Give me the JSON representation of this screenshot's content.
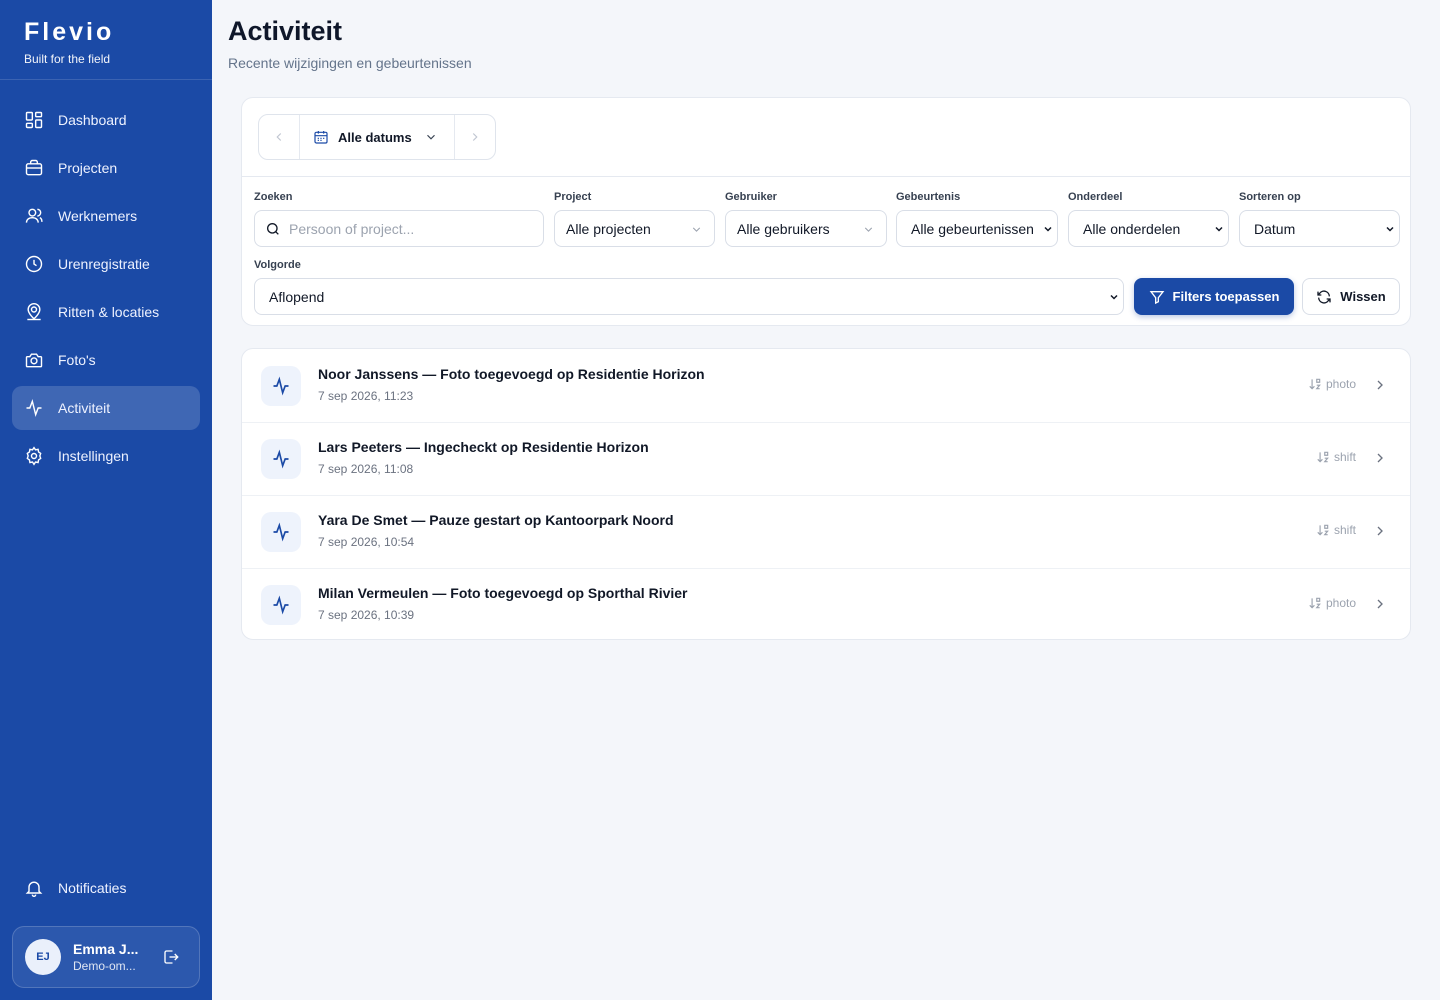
{
  "app": {
    "name": "Flevio",
    "tagline": "Built for the field"
  },
  "sidebar": {
    "items": [
      {
        "label": "Dashboard",
        "icon": "dashboard-icon"
      },
      {
        "label": "Projecten",
        "icon": "briefcase-icon"
      },
      {
        "label": "Werknemers",
        "icon": "users-icon"
      },
      {
        "label": "Urenregistratie",
        "icon": "clock-icon"
      },
      {
        "label": "Ritten & locaties",
        "icon": "map-pin-icon"
      },
      {
        "label": "Foto's",
        "icon": "camera-icon"
      },
      {
        "label": "Activiteit",
        "icon": "activity-icon",
        "active": true
      },
      {
        "label": "Instellingen",
        "icon": "gear-icon"
      }
    ],
    "notifications_label": "Notificaties",
    "user": {
      "initials": "EJ",
      "name": "Emma J...",
      "org": "Demo-om..."
    }
  },
  "page": {
    "title": "Activiteit",
    "subtitle": "Recente wijzigingen en gebeurtenissen"
  },
  "filters": {
    "date_range": "Alle datums",
    "search": {
      "label": "Zoeken",
      "placeholder": "Persoon of project..."
    },
    "project": {
      "label": "Project",
      "value": "Alle projecten"
    },
    "user": {
      "label": "Gebruiker",
      "value": "Alle gebruikers"
    },
    "event": {
      "label": "Gebeurtenis",
      "value": "Alle gebeurtenissen"
    },
    "section": {
      "label": "Onderdeel",
      "value": "Alle onderdelen"
    },
    "sort": {
      "label": "Sorteren op",
      "value": "Datum"
    },
    "order": {
      "label": "Volgorde",
      "value": "Aflopend"
    },
    "apply_label": "Filters toepassen",
    "clear_label": "Wissen"
  },
  "activities": [
    {
      "title": "Noor Janssens — Foto toegevoegd op Residentie Horizon",
      "time": "7 sep 2026, 11:23",
      "type": "photo"
    },
    {
      "title": "Lars Peeters — Ingecheckt op Residentie Horizon",
      "time": "7 sep 2026, 11:08",
      "type": "shift"
    },
    {
      "title": "Yara De Smet — Pauze gestart op Kantoorpark Noord",
      "time": "7 sep 2026, 10:54",
      "type": "shift"
    },
    {
      "title": "Milan Vermeulen — Foto toegevoegd op Sporthal Rivier",
      "time": "7 sep 2026, 10:39",
      "type": "photo"
    }
  ],
  "colors": {
    "primary": "#1b4aa6",
    "background": "#f4f6fa"
  }
}
